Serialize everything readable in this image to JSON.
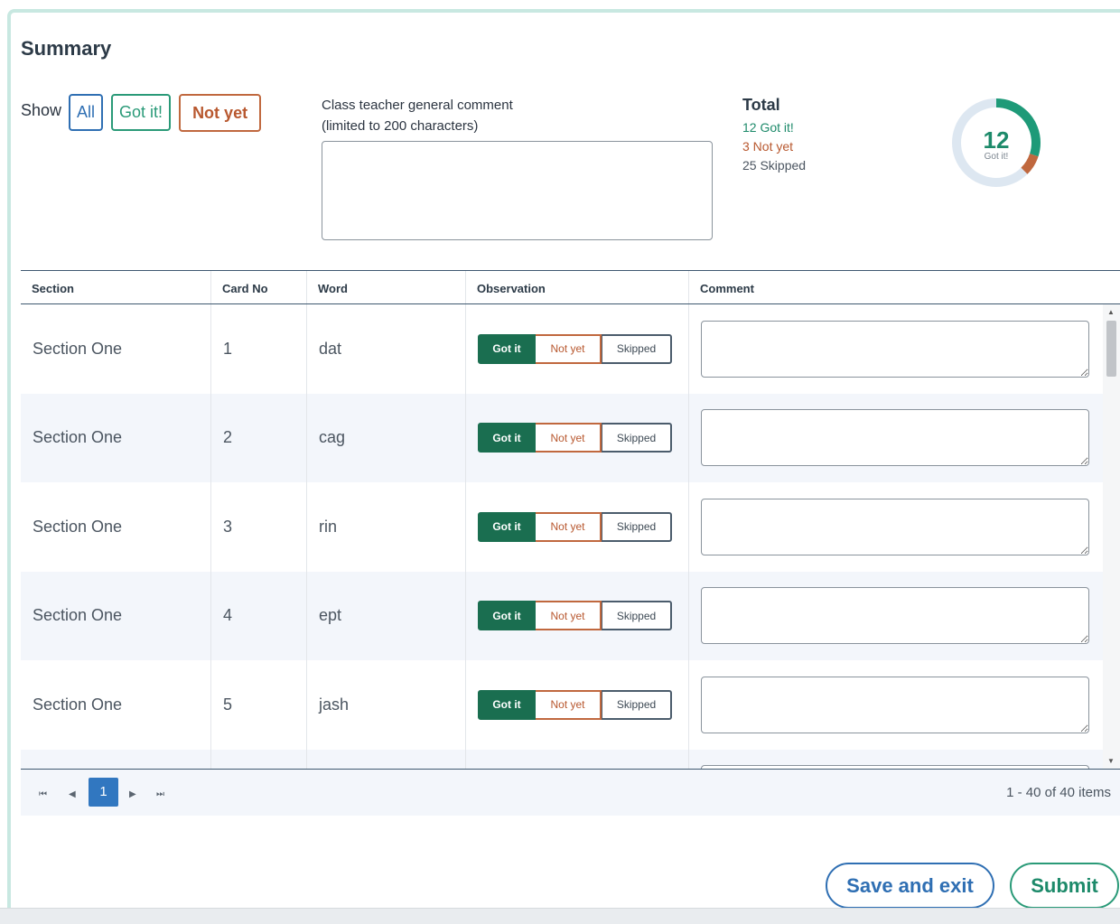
{
  "summary": {
    "title": "Summary"
  },
  "filters": {
    "show_label": "Show",
    "all": "All",
    "got": "Got it!",
    "not": "Not yet"
  },
  "general_comment": {
    "label_line1": "Class teacher general comment",
    "label_line2": "(limited to 200 characters)",
    "value": ""
  },
  "totals": {
    "title": "Total",
    "got": "12 Got it!",
    "not": "3 Not yet",
    "skipped": "25 Skipped"
  },
  "donut": {
    "number": "12",
    "sub": "Got it!",
    "got_count": 12,
    "not_count": 3,
    "skipped_count": 25,
    "colors": {
      "got": "#1e9a78",
      "not": "#c0683e",
      "skipped": "#dde7f1"
    }
  },
  "table": {
    "headers": {
      "section": "Section",
      "card_no": "Card No",
      "word": "Word",
      "observation": "Observation",
      "comment": "Comment"
    },
    "obs_labels": {
      "got": "Got it",
      "not": "Not yet",
      "skipped": "Skipped"
    },
    "rows": [
      {
        "section": "Section One",
        "card_no": "1",
        "word": "dat",
        "comment": ""
      },
      {
        "section": "Section One",
        "card_no": "2",
        "word": "cag",
        "comment": ""
      },
      {
        "section": "Section One",
        "card_no": "3",
        "word": "rin",
        "comment": ""
      },
      {
        "section": "Section One",
        "card_no": "4",
        "word": "ept",
        "comment": ""
      },
      {
        "section": "Section One",
        "card_no": "5",
        "word": "jash",
        "comment": ""
      },
      {
        "section": "",
        "card_no": "",
        "word": "",
        "comment": ""
      }
    ]
  },
  "pager": {
    "current_page": "1",
    "info": "1 - 40 of 40 items"
  },
  "actions": {
    "save_exit": "Save and exit",
    "submit": "Submit"
  }
}
